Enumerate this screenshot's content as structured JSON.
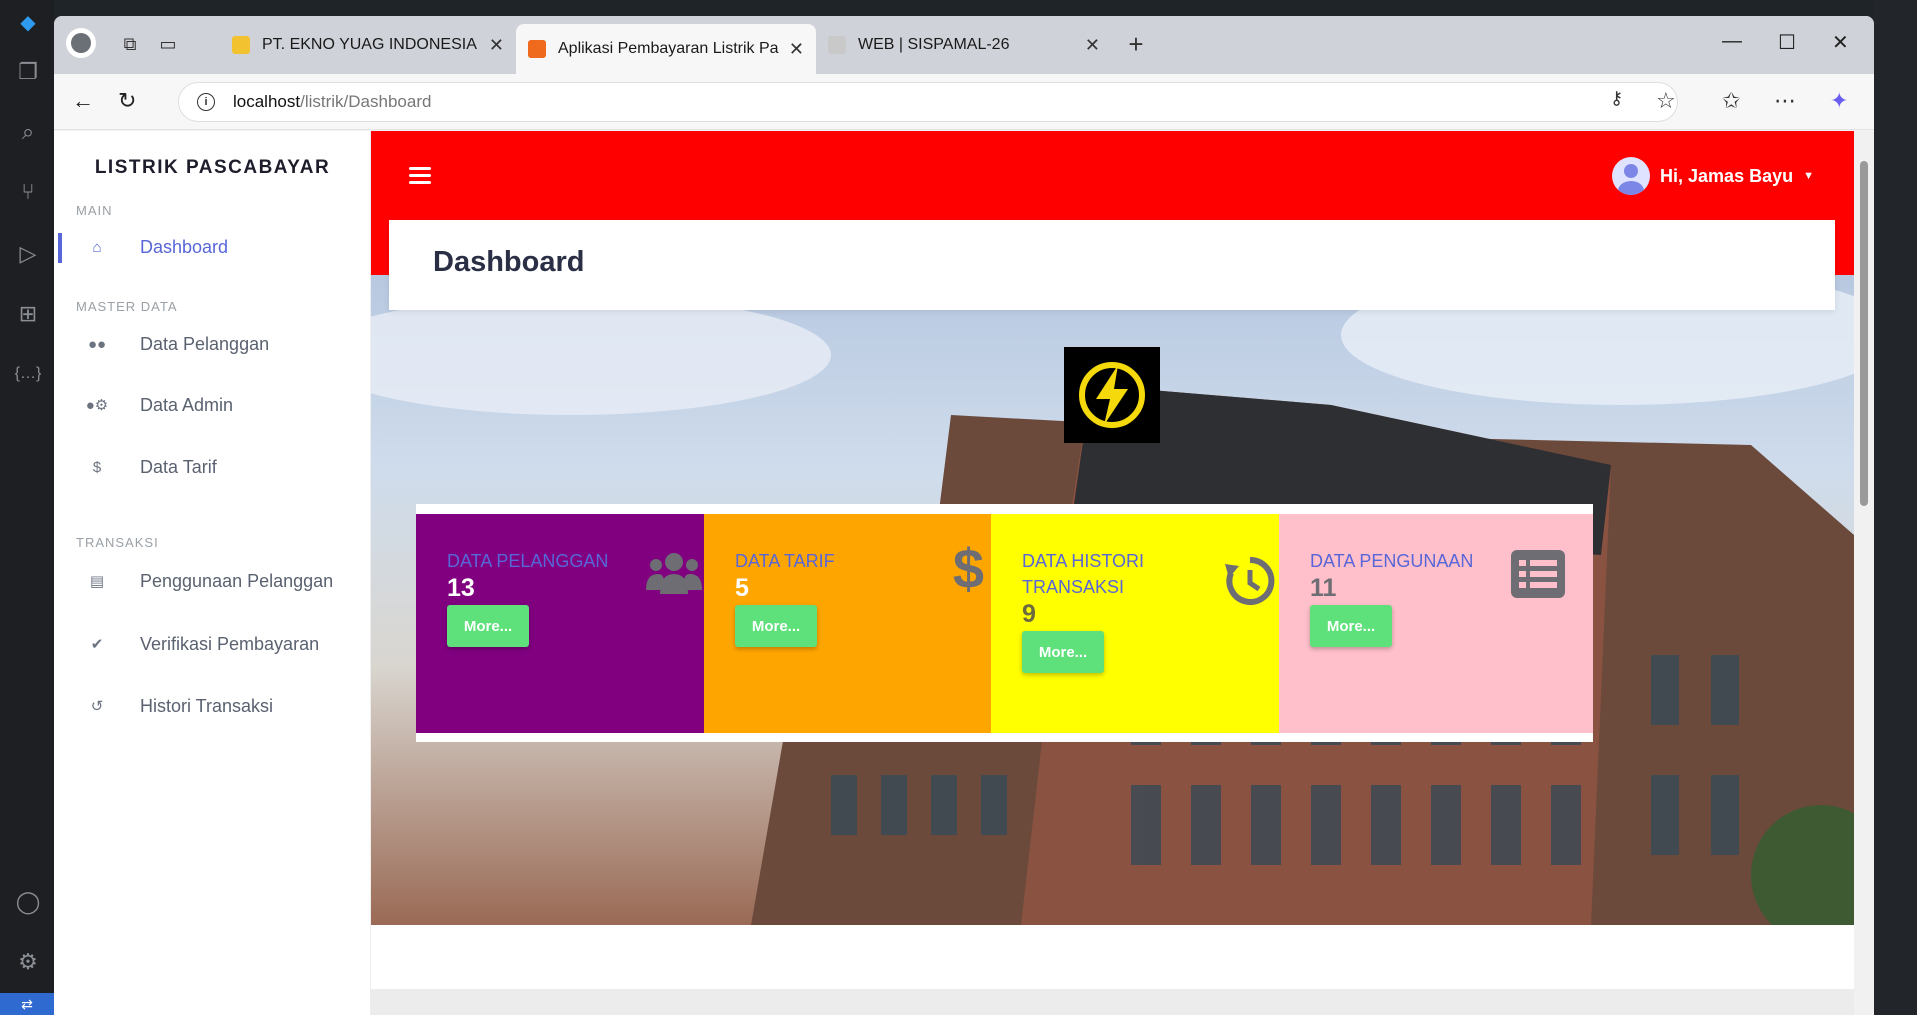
{
  "browser": {
    "tabs": [
      {
        "title": "PT. EKNO YUAG INDONESIA",
        "active": false
      },
      {
        "title": "Aplikasi Pembayaran Listrik Pascabayar",
        "active": true
      },
      {
        "title": "WEB | SISPAMAL-26",
        "active": false
      }
    ],
    "url_host": "localhost",
    "url_path": "/listrik/Dashboard"
  },
  "sidebar": {
    "brand": "LISTRIK PASCABAYAR",
    "sections": {
      "main": "MAIN",
      "master": "MASTER DATA",
      "transaksi": "TRANSAKSI"
    },
    "items": [
      {
        "label": "Dashboard",
        "icon": "home-icon"
      },
      {
        "label": "Data Pelanggan",
        "icon": "users-icon"
      },
      {
        "label": "Data Admin",
        "icon": "user-cog-icon"
      },
      {
        "label": "Data Tarif",
        "icon": "dollar-icon"
      },
      {
        "label": "Penggunaan Pelanggan",
        "icon": "list-icon"
      },
      {
        "label": "Verifikasi Pembayaran",
        "icon": "check-double-icon"
      },
      {
        "label": "Histori Transaksi",
        "icon": "history-icon"
      }
    ]
  },
  "header": {
    "user_greeting": "Hi, Jamas Bayu",
    "page_title": "Dashboard"
  },
  "cards": [
    {
      "label": "DATA PELANGGAN",
      "value": "13",
      "button": "More...",
      "color": "#800080",
      "icon": "users-icon"
    },
    {
      "label": "DATA TARIF",
      "value": "5",
      "button": "More...",
      "color": "#ffa500",
      "icon": "dollar-icon"
    },
    {
      "label": "DATA HISTORI TRANSAKSI",
      "value": "9",
      "button": "More...",
      "color": "#ffff00",
      "icon": "history-icon"
    },
    {
      "label": "DATA PENGUNAAN",
      "value": "11",
      "button": "More...",
      "color": "#ffc0cb",
      "icon": "list-icon"
    }
  ],
  "colors": {
    "topbar": "#ff0000",
    "accent": "#5866d8",
    "more_button": "#5ee07a"
  }
}
